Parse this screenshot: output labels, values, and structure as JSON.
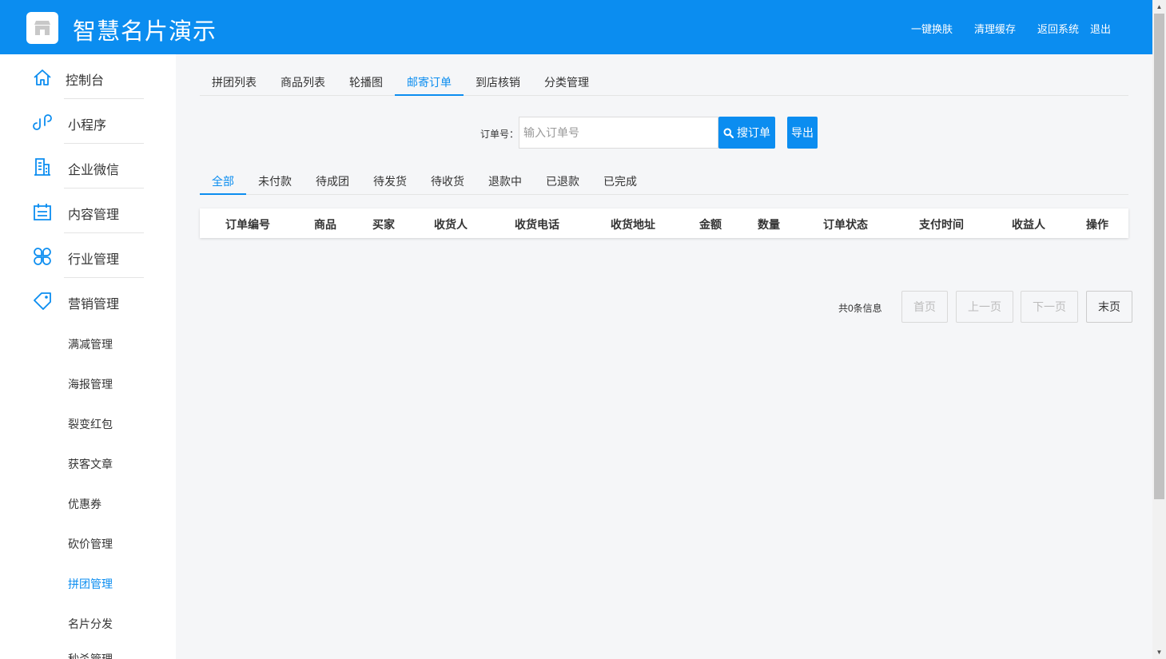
{
  "header": {
    "title": "智慧名片演示",
    "links": [
      "一键换肤",
      "清理缓存",
      "返回系统",
      "退出"
    ]
  },
  "sidebar": {
    "items": [
      {
        "label": "控制台",
        "icon": "home-icon"
      },
      {
        "label": "小程序",
        "icon": "link-icon"
      },
      {
        "label": "企业微信",
        "icon": "building-icon"
      },
      {
        "label": "内容管理",
        "icon": "calendar-icon"
      },
      {
        "label": "行业管理",
        "icon": "clover-icon"
      },
      {
        "label": "营销管理",
        "icon": "tag-icon"
      }
    ],
    "sub_items": [
      "满减管理",
      "海报管理",
      "裂变红包",
      "获客文章",
      "优惠券",
      "砍价管理",
      "拼团管理",
      "名片分发",
      "秒杀管理"
    ],
    "active_sub": "拼团管理"
  },
  "top_tabs": {
    "items": [
      "拼团列表",
      "商品列表",
      "轮播图",
      "邮寄订单",
      "到店核销",
      "分类管理"
    ],
    "active": "邮寄订单"
  },
  "search": {
    "label": "订单号：",
    "placeholder": "输入订单号",
    "value": "",
    "search_button": "搜订单",
    "export_button": "导出"
  },
  "status_tabs": {
    "items": [
      "全部",
      "未付款",
      "待成团",
      "待发货",
      "待收货",
      "退款中",
      "已退款",
      "已完成"
    ],
    "active": "全部"
  },
  "table": {
    "columns": [
      "订单编号",
      "商品",
      "买家",
      "收货人",
      "收货电话",
      "收货地址",
      "金额",
      "数量",
      "订单状态",
      "支付时间",
      "收益人",
      "操作"
    ],
    "rows": []
  },
  "pagination": {
    "info": "共0条信息",
    "first": "首页",
    "prev": "上一页",
    "next": "下一页",
    "last": "末页"
  },
  "colors": {
    "primary": "#0b8df0",
    "background": "#f5f6f8"
  }
}
